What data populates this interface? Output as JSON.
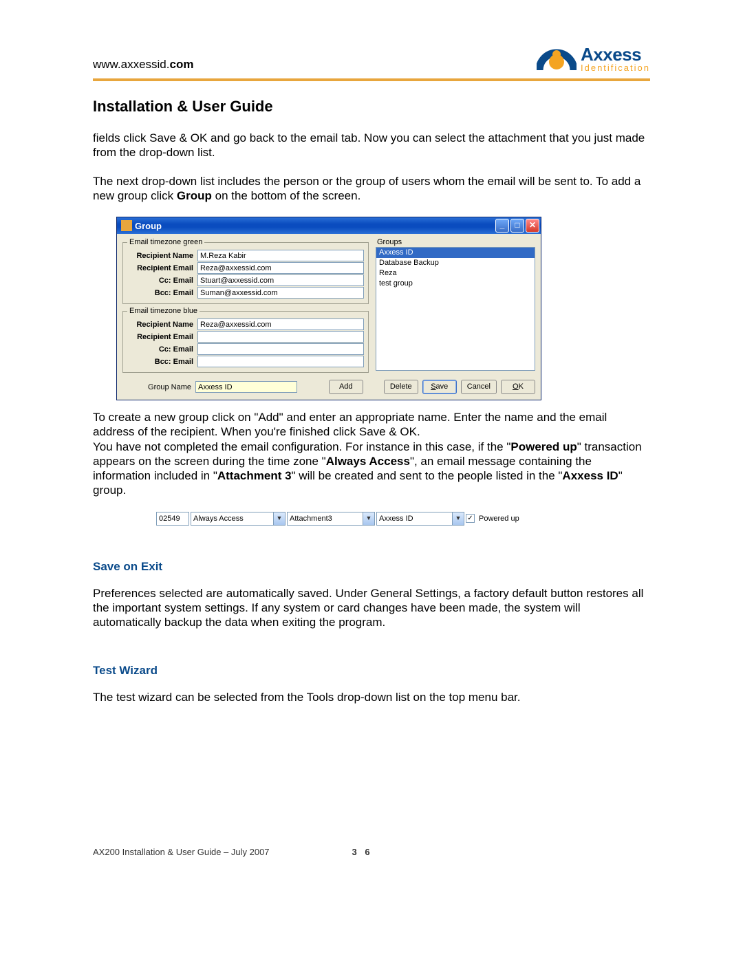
{
  "header": {
    "url_prefix": "www.axxessid.",
    "url_bold": "com",
    "logo_top": "Axxess",
    "logo_bottom": "Identification"
  },
  "title": "Installation & User Guide",
  "p1a": "fields click Save & OK and go back to the email tab. Now you can select the attachment that you just made from the drop-down list.",
  "p1b_a": "The next drop-down list includes the person or the group of users whom the email will be sent to. To add a new group click ",
  "p1b_bold": "Group",
  "p1b_c": " on the bottom of the screen.",
  "dialog": {
    "title": "Group",
    "fs_green": {
      "legend": "Email timezone green",
      "rows": [
        {
          "label": "Recipient Name",
          "value": "M.Reza Kabir"
        },
        {
          "label": "Recipient Email",
          "value": "Reza@axxessid.com"
        },
        {
          "label": "Cc: Email",
          "value": "Stuart@axxessid.com"
        },
        {
          "label": "Bcc: Email",
          "value": "Suman@axxessid.com"
        }
      ]
    },
    "fs_blue": {
      "legend": "Email timezone blue",
      "rows": [
        {
          "label": "Recipient Name",
          "value": "Reza@axxessid.com"
        },
        {
          "label": "Recipient Email",
          "value": ""
        },
        {
          "label": "Cc: Email",
          "value": ""
        },
        {
          "label": "Bcc: Email",
          "value": ""
        }
      ]
    },
    "groups_label": "Groups",
    "groups_items": [
      "Axxess ID",
      "Database Backup",
      "Reza",
      "test group"
    ],
    "group_name_label": "Group Name",
    "group_name_value": "Axxess ID",
    "buttons": {
      "add": "Add",
      "delete": "Delete",
      "save": "Save",
      "cancel": "Cancel",
      "ok": "OK"
    }
  },
  "p2a": "To create a new group click on \"Add\" and enter an appropriate name. Enter the name and the email address of the recipient. When you're finished click Save & OK.",
  "p2b_parts": [
    "You have not completed the email configuration. For instance in this case, if the \"",
    "Powered up",
    "\" transaction appears on the screen during the time zone \"",
    "Always Access",
    "\", an email message containing the information included in \"",
    "Attachment 3",
    "\" will be created and sent to the people listed in the \"",
    "Axxess ID",
    "\" group."
  ],
  "strip": {
    "code": "02549",
    "tz": "Always Access",
    "att": "Attachment3",
    "grp": "Axxess ID",
    "chk_label": "Powered up"
  },
  "sec_save": {
    "heading": "Save on Exit",
    "body": "Preferences selected are automatically saved. Under General Settings, a factory default button restores all the important system settings.  If any system or card changes have been made, the system will automatically backup the data when exiting the program."
  },
  "sec_test": {
    "heading": "Test Wizard",
    "body": "The test wizard can be selected from the Tools drop-down list on the top menu bar."
  },
  "footer": {
    "left": "AX200 Installation & User Guide – July 2007",
    "page": "3 6"
  }
}
